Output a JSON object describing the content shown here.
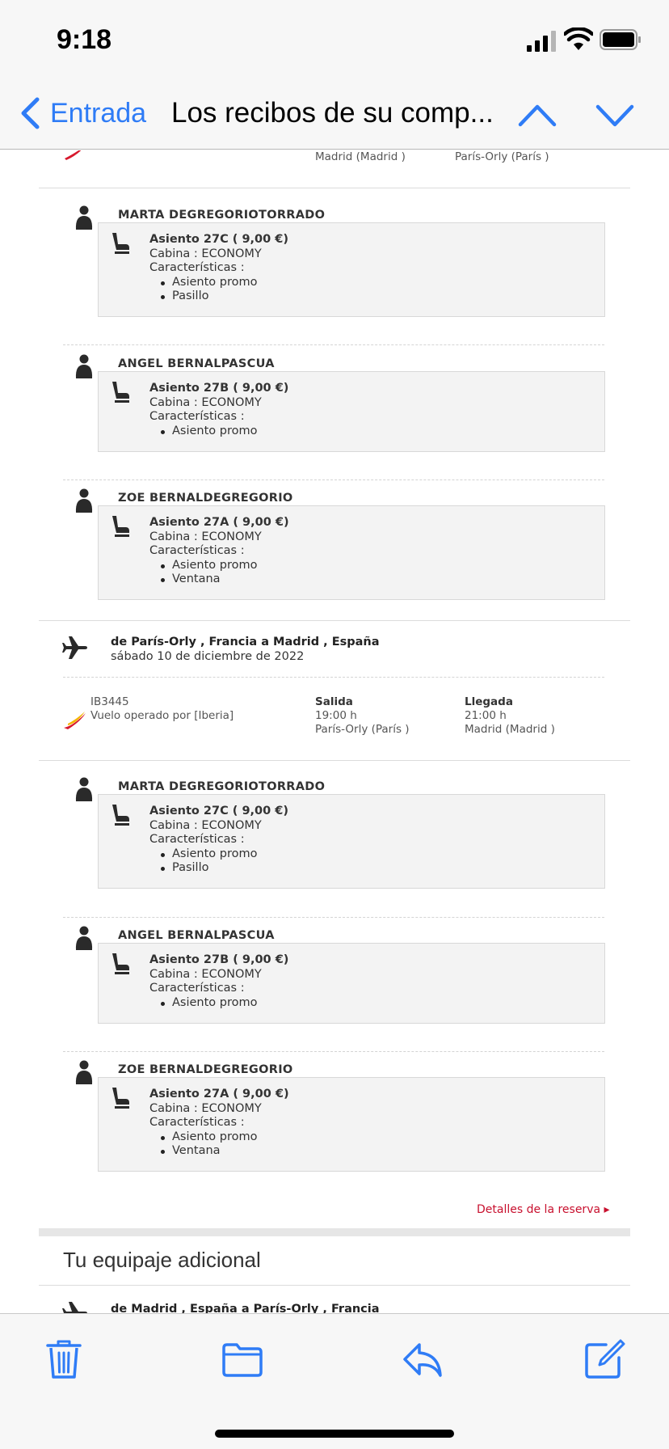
{
  "status_bar": {
    "time": "9:18"
  },
  "nav": {
    "back_label": "Entrada",
    "title": "Los recibos de su comp..."
  },
  "top_partial": {
    "from_city": "Madrid (Madrid )",
    "to_city": "París-Orly (París )"
  },
  "outbound_passengers": [
    {
      "name": "MARTA DEGREGORIOTORRADO",
      "seat": "Asiento 27C ( 9,00 €)",
      "cabin": "Cabina : ECONOMY",
      "features_label": "Características :",
      "features": [
        "Asiento promo",
        "Pasillo"
      ]
    },
    {
      "name": "ANGEL BERNALPASCUA",
      "seat": "Asiento 27B ( 9,00 €)",
      "cabin": "Cabina : ECONOMY",
      "features_label": "Características :",
      "features": [
        "Asiento promo"
      ]
    },
    {
      "name": "ZOE BERNALDEGREGORIO",
      "seat": "Asiento 27A ( 9,00 €)",
      "cabin": "Cabina : ECONOMY",
      "features_label": "Características :",
      "features": [
        "Asiento promo",
        "Ventana"
      ]
    }
  ],
  "return_flight": {
    "route": "de París-Orly , Francia a Madrid , España",
    "date": "sábado 10 de diciembre de 2022",
    "flight_number": "IB3445",
    "operated_by": "Vuelo operado por [Iberia]",
    "departure_label": "Salida",
    "departure_time": "19:00 h",
    "departure_city": "París-Orly (París )",
    "arrival_label": "Llegada",
    "arrival_time": "21:00 h",
    "arrival_city": "Madrid (Madrid )"
  },
  "return_passengers": [
    {
      "name": "MARTA DEGREGORIOTORRADO",
      "seat": "Asiento 27C ( 9,00 €)",
      "cabin": "Cabina : ECONOMY",
      "features_label": "Características :",
      "features": [
        "Asiento promo",
        "Pasillo"
      ]
    },
    {
      "name": "ANGEL BERNALPASCUA",
      "seat": "Asiento 27B ( 9,00 €)",
      "cabin": "Cabina : ECONOMY",
      "features_label": "Características :",
      "features": [
        "Asiento promo"
      ]
    },
    {
      "name": "ZOE BERNALDEGREGORIO",
      "seat": "Asiento 27A ( 9,00 €)",
      "cabin": "Cabina : ECONOMY",
      "features_label": "Características :",
      "features": [
        "Asiento promo",
        "Ventana"
      ]
    }
  ],
  "booking_details_link": "Detalles de la reserva ▸",
  "baggage_section": {
    "title": "Tu equipaje adicional",
    "first_route": "de Madrid , España a París-Orly , Francia"
  },
  "colors": {
    "accent": "#2f7cf6",
    "link_red": "#c8102e",
    "seat_box": "#f3f3f3"
  },
  "icons": [
    "chevron-left-icon",
    "chevron-up-icon",
    "chevron-down-icon",
    "person-icon",
    "seat-icon",
    "airplane-icon",
    "iberia-logo",
    "trash-icon",
    "folder-icon",
    "reply-icon",
    "compose-icon"
  ]
}
